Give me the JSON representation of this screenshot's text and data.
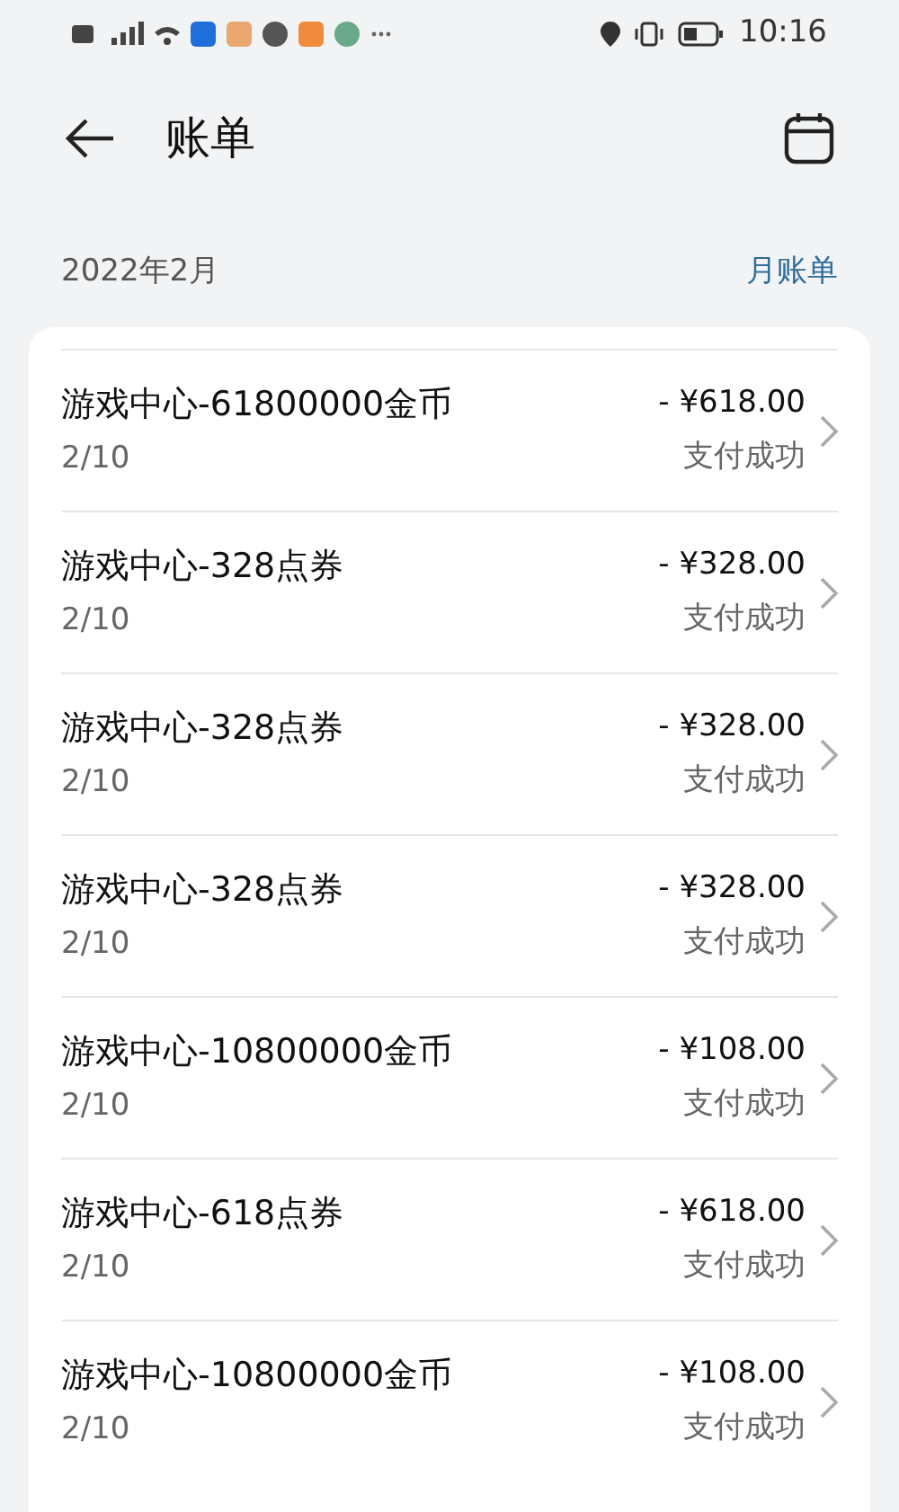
{
  "status_bar": {
    "time": "10:16"
  },
  "header": {
    "title": "账单"
  },
  "section": {
    "month": "2022年2月",
    "link": "月账单"
  },
  "transactions": [
    {
      "title": "游戏中心-61800000金币",
      "date": "2/10",
      "amount": "- ¥618.00",
      "status": "支付成功"
    },
    {
      "title": "游戏中心-328点券",
      "date": "2/10",
      "amount": "- ¥328.00",
      "status": "支付成功"
    },
    {
      "title": "游戏中心-328点券",
      "date": "2/10",
      "amount": "- ¥328.00",
      "status": "支付成功"
    },
    {
      "title": "游戏中心-328点券",
      "date": "2/10",
      "amount": "- ¥328.00",
      "status": "支付成功"
    },
    {
      "title": "游戏中心-10800000金币",
      "date": "2/10",
      "amount": "- ¥108.00",
      "status": "支付成功"
    },
    {
      "title": "游戏中心-618点券",
      "date": "2/10",
      "amount": "- ¥618.00",
      "status": "支付成功"
    },
    {
      "title": "游戏中心-10800000金币",
      "date": "2/10",
      "amount": "- ¥108.00",
      "status": "支付成功"
    }
  ]
}
